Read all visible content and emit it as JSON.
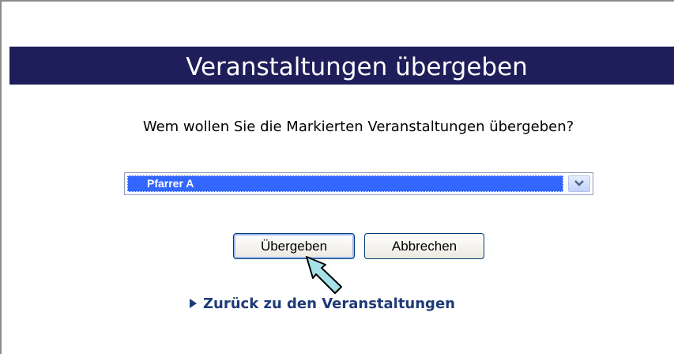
{
  "title": "Veranstaltungen übergeben",
  "question": "Wem wollen Sie die Markierten Veranstaltungen übergeben?",
  "select": {
    "selected": "Pfarrer A",
    "arrow_icon": "chevron-down-icon"
  },
  "buttons": {
    "submit": "Übergeben",
    "cancel": "Abbrechen"
  },
  "back_link": {
    "label": "Zurück zu den Veranstaltungen",
    "icon": "triangle-right-icon"
  },
  "colors": {
    "title_bg": "#1e1e5a",
    "select_highlight": "#3366ff",
    "link": "#1e3a78"
  }
}
